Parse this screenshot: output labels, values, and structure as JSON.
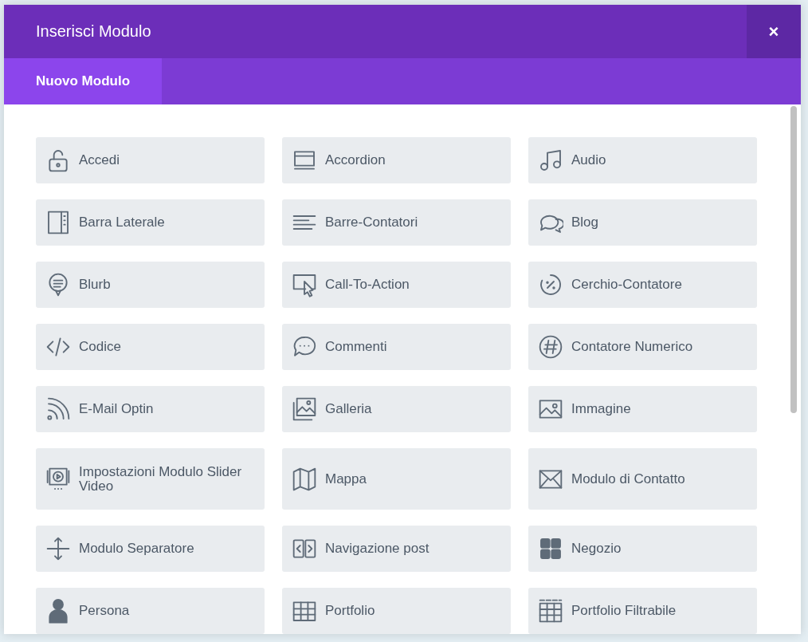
{
  "dialog": {
    "title": "Inserisci Modulo",
    "close": "×"
  },
  "tabs": [
    {
      "label": "Nuovo Modulo",
      "selected": true
    }
  ],
  "modules": [
    {
      "label": "Accedi"
    },
    {
      "label": "Accordion"
    },
    {
      "label": "Audio"
    },
    {
      "label": "Barra Laterale"
    },
    {
      "label": "Barre-Contatori"
    },
    {
      "label": "Blog"
    },
    {
      "label": "Blurb"
    },
    {
      "label": "Call-To-Action"
    },
    {
      "label": "Cerchio-Contatore"
    },
    {
      "label": "Codice"
    },
    {
      "label": "Commenti"
    },
    {
      "label": "Contatore Numerico"
    },
    {
      "label": "E-Mail Optin"
    },
    {
      "label": "Galleria"
    },
    {
      "label": "Immagine"
    },
    {
      "label": "Impostazioni Modulo Slider Video"
    },
    {
      "label": "Mappa"
    },
    {
      "label": "Modulo di Contatto"
    },
    {
      "label": "Modulo Separatore"
    },
    {
      "label": "Navigazione post"
    },
    {
      "label": "Negozio"
    },
    {
      "label": "Persona"
    },
    {
      "label": "Portfolio"
    },
    {
      "label": "Portfolio Filtrabile"
    }
  ]
}
